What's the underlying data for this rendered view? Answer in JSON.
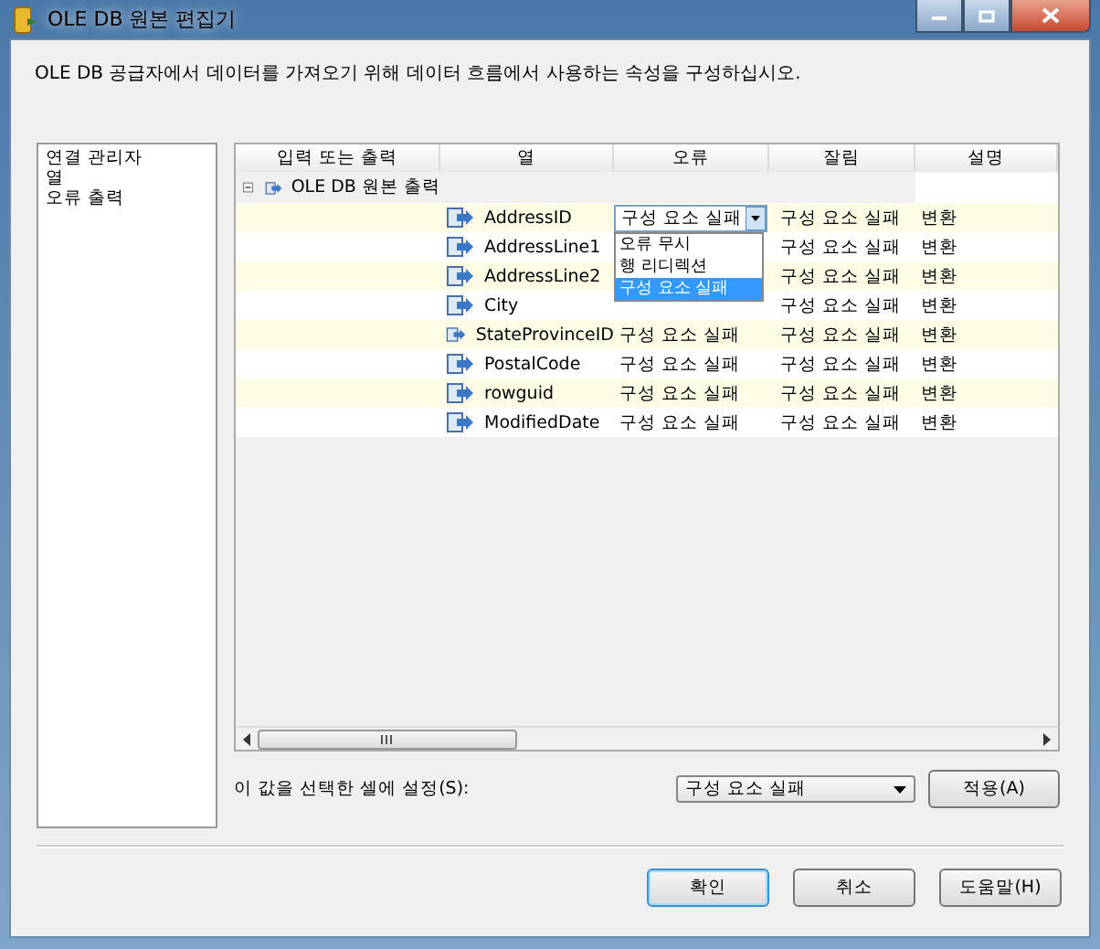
{
  "window": {
    "title": "OLE DB 원본 편집기"
  },
  "description": "OLE DB 공급자에서 데이터를 가져오기 위해 데이터 흐름에서 사용하는 속성을 구성하십시오.",
  "sidebar": {
    "items": [
      {
        "label": "연결 관리자"
      },
      {
        "label": "열"
      },
      {
        "label": "오류 출력"
      }
    ]
  },
  "grid": {
    "columns": [
      "입력 또는 출력",
      "열",
      "오류",
      "잘림",
      "설명"
    ],
    "group": {
      "label": "OLE DB 원본 출력",
      "expanded": true
    },
    "rows": [
      {
        "column": "AddressID",
        "error": "구성 요소 실패",
        "truncation": "구성 요소 실패",
        "description": "변환",
        "editing": true
      },
      {
        "column": "AddressLine1",
        "truncation": "구성 요소 실패",
        "description": "변환",
        "editing": false
      },
      {
        "column": "AddressLine2",
        "truncation": "구성 요소 실패",
        "description": "변환",
        "editing": false
      },
      {
        "column": "City",
        "truncation": "구성 요소 실패",
        "description": "변환",
        "editing": false
      },
      {
        "column": "StateProvinceID",
        "error": "구성 요소 실패",
        "truncation": "구성 요소 실패",
        "description": "변환",
        "editing": false
      },
      {
        "column": "PostalCode",
        "error": "구성 요소 실패",
        "truncation": "구성 요소 실패",
        "description": "변환",
        "editing": false
      },
      {
        "column": "rowguid",
        "error": "구성 요소 실패",
        "truncation": "구성 요소 실패",
        "description": "변환",
        "editing": false
      },
      {
        "column": "ModifiedDate",
        "error": "구성 요소 실패",
        "truncation": "구성 요소 실패",
        "description": "변환",
        "editing": false
      }
    ],
    "dropdown_options": [
      {
        "label": "오류 무시",
        "selected": false
      },
      {
        "label": "행 리디렉션",
        "selected": false
      },
      {
        "label": "구성 요소 실패",
        "selected": true
      }
    ]
  },
  "set_value": {
    "label": "이 값을 선택한 셀에 설정(S):",
    "value": "구성 요소 실패",
    "apply_button": "적용(A)"
  },
  "buttons": [
    {
      "label": "확인",
      "default": true
    },
    {
      "label": "취소",
      "default": false
    },
    {
      "label": "도움말(H)",
      "default": false
    }
  ]
}
